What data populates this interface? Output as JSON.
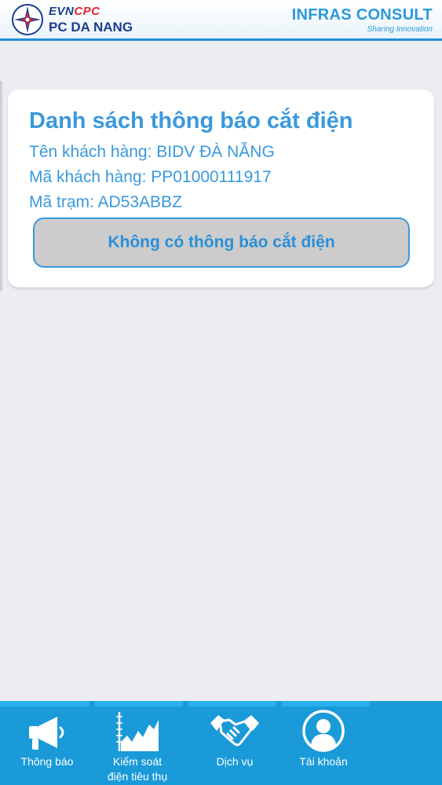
{
  "header": {
    "logo_evn_blue": "EVN",
    "logo_evn_red": "CPC",
    "logo_pc": "PC DA NANG",
    "logo_infras": "INFRAS CONSULT",
    "logo_sharing": "Sharing Innovation"
  },
  "card": {
    "title": "Danh sách thông báo cắt điện",
    "customer_name": "Tên khách hàng: BIDV ĐÀ NẴNG",
    "customer_code": "Mã khách hàng: PP01000111917",
    "station_code": "Mã trạm: AD53ABBZ",
    "status": "Không có thông báo cắt điện"
  },
  "nav": {
    "items": [
      {
        "label": "Thông báo",
        "icon": "megaphone-icon"
      },
      {
        "label": "Kiểm soát",
        "label2": "điện tiêu thụ",
        "icon": "consumption-chart-icon"
      },
      {
        "label": "Dịch vụ",
        "icon": "handshake-icon"
      },
      {
        "label": "Tài khoản",
        "icon": "user-icon"
      }
    ]
  },
  "colors": {
    "accent": "#3a99dc",
    "nav_bg": "#1a9ad8",
    "background": "#ececf1"
  }
}
